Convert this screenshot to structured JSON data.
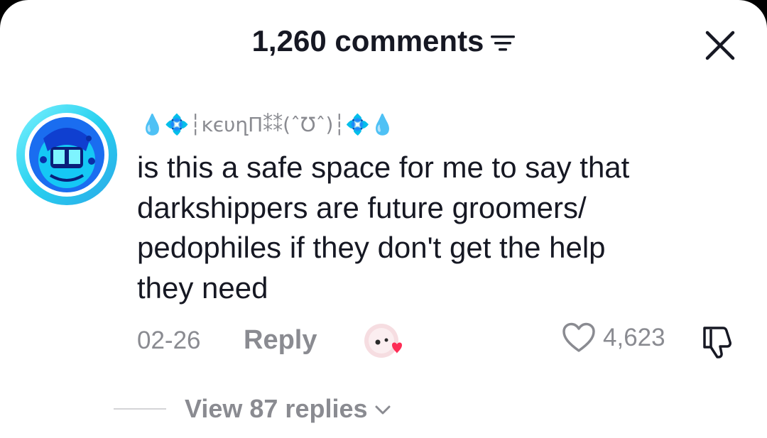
{
  "header": {
    "title": "1,260 comments",
    "filter_icon": "filter-lines-icon",
    "close_icon": "close-icon"
  },
  "comment": {
    "username": "💧💠┆ĸєυղΠ⁑⁑(ˆ℧ˆ)┆💠💧",
    "text": "is this a safe space for me to say that\ndarkshippers are future groomers/\npedophiles if they don't get the help\nthey need",
    "date": "02-26",
    "reply_label": "Reply",
    "like_count": "4,623"
  },
  "replies": {
    "label": "View 87 replies"
  },
  "colors": {
    "text_primary": "#161823",
    "text_secondary": "#8a8b91",
    "avatar_ring": "#27d0ef",
    "heart_red": "#fe2c55"
  }
}
